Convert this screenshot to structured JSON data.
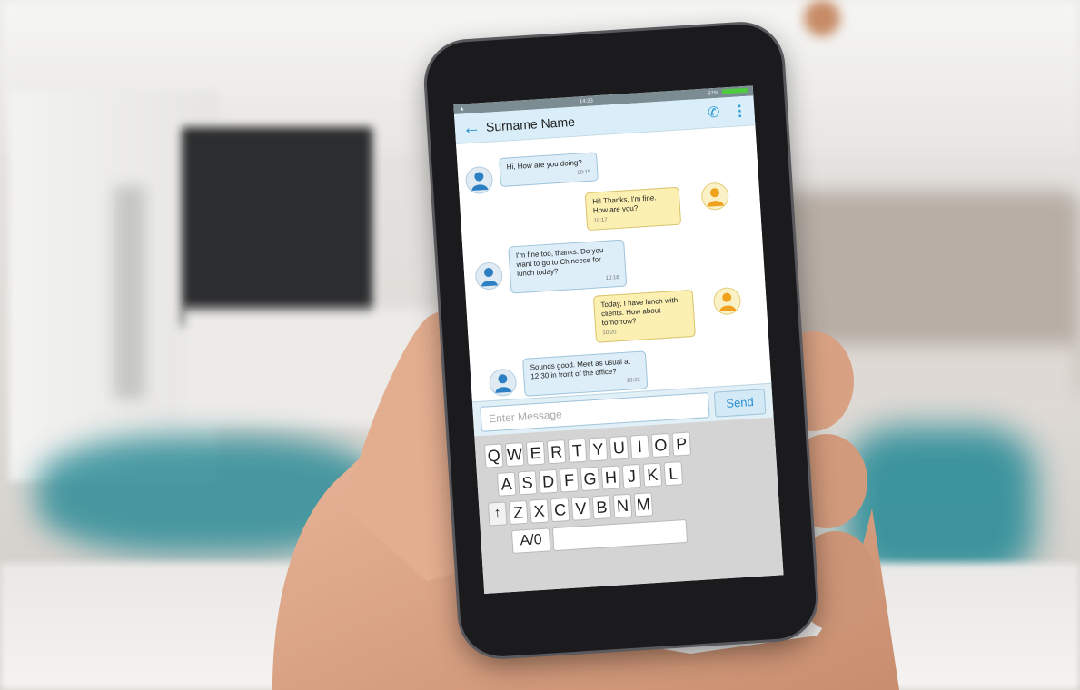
{
  "status": {
    "time": "14:23",
    "battery": "97%"
  },
  "header": {
    "title": "Surname Name",
    "back_icon": "back-arrow-icon",
    "call_icon": "phone-icon",
    "menu_icon": "more-vertical-icon"
  },
  "messages": [
    {
      "side": "incoming",
      "text": "Hi, How are you doing?",
      "time": "10:15"
    },
    {
      "side": "outgoing",
      "text": "Hi! Thanks, I'm fine. How are you?",
      "time": "10:17"
    },
    {
      "side": "incoming",
      "text": "I'm fine too, thanks. Do you want to go to Chineese for lunch today?",
      "time": "10:18"
    },
    {
      "side": "outgoing",
      "text": "Today, I have lunch with clients. How about tomorrow?",
      "time": "10:20"
    },
    {
      "side": "incoming",
      "text": "Sounds good. Meet as usual at 12:30 in front of the office?",
      "time": "10:23"
    }
  ],
  "composer": {
    "placeholder": "Enter Message",
    "send_label": "Send"
  },
  "keyboard": {
    "row1": [
      "Q",
      "W",
      "E",
      "R",
      "T",
      "Y",
      "U",
      "I",
      "O",
      "P"
    ],
    "row2": [
      "A",
      "S",
      "D",
      "F",
      "G",
      "H",
      "J",
      "K",
      "L"
    ],
    "row3_shift": "↑",
    "row3": [
      "Z",
      "X",
      "C",
      "V",
      "B",
      "N",
      "M"
    ],
    "mode_label": "A/0"
  },
  "colors": {
    "header_bg": "#d9eef8",
    "incoming_bubble": "#ddeef8",
    "outgoing_bubble": "#fbefb1",
    "accent": "#2a8fd0",
    "battery": "#4ecb3e"
  }
}
